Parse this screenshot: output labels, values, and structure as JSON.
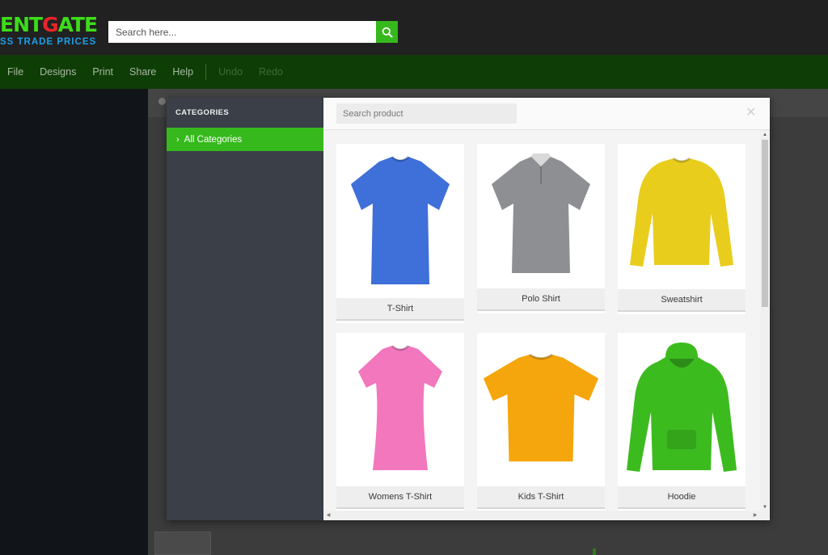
{
  "header": {
    "logo_top_a": "ENT",
    "logo_top_b": "G",
    "logo_top_c": "ATE",
    "logo_bottom": "SS TRADE PRICES",
    "search_placeholder": "Search here..."
  },
  "menu": {
    "items": [
      "File",
      "Designs",
      "Print",
      "Share",
      "Help"
    ],
    "disabled": [
      "Undo",
      "Redo"
    ]
  },
  "modal": {
    "categories_title": "CATEGORIES",
    "active_category": "All Categories",
    "product_search_placeholder": "Search product",
    "close_glyph": "✕",
    "products": [
      {
        "label": "T-Shirt",
        "color": "#3f6fd8"
      },
      {
        "label": "Polo Shirt",
        "color": "#8d8f93"
      },
      {
        "label": "Sweatshirt",
        "color": "#e9cd1d"
      },
      {
        "label": "Womens T-Shirt",
        "color": "#f277bd"
      },
      {
        "label": "Kids T-Shirt",
        "color": "#f5a60c"
      },
      {
        "label": "Hoodie",
        "color": "#3cbb1f"
      }
    ]
  },
  "colors": {
    "accent": "#35b91c",
    "menubar": "#0e3e05",
    "header": "#212121"
  }
}
